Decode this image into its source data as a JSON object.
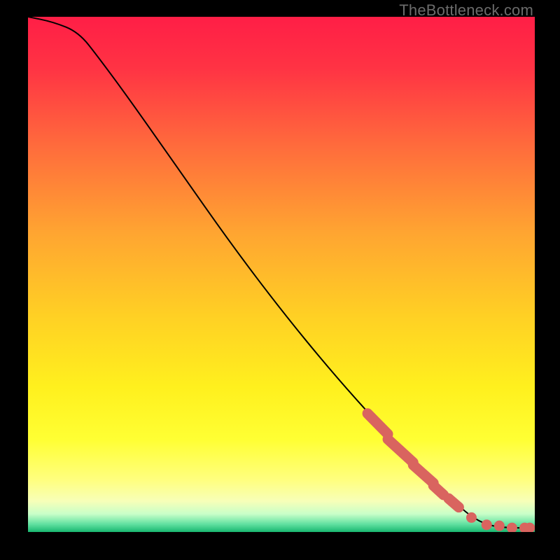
{
  "watermark": "TheBottleneck.com",
  "colors": {
    "marker": "#d9645f"
  },
  "chart_data": {
    "type": "line",
    "title": "",
    "xlabel": "",
    "ylabel": "",
    "xlim": [
      0,
      100
    ],
    "ylim": [
      0,
      100
    ],
    "grid": false,
    "legend": false,
    "curve": [
      {
        "x": 0,
        "y": 100
      },
      {
        "x": 5,
        "y": 99
      },
      {
        "x": 10,
        "y": 97
      },
      {
        "x": 14,
        "y": 92
      },
      {
        "x": 20,
        "y": 84
      },
      {
        "x": 30,
        "y": 70
      },
      {
        "x": 40,
        "y": 56
      },
      {
        "x": 50,
        "y": 43
      },
      {
        "x": 60,
        "y": 31
      },
      {
        "x": 70,
        "y": 20
      },
      {
        "x": 80,
        "y": 10
      },
      {
        "x": 86,
        "y": 4
      },
      {
        "x": 90,
        "y": 1.5
      },
      {
        "x": 94,
        "y": 0.8
      },
      {
        "x": 100,
        "y": 0.8
      }
    ],
    "marker_segments": [
      {
        "x0": 67,
        "y0": 23,
        "x1": 71,
        "y1": 19
      },
      {
        "x0": 71,
        "y0": 18,
        "x1": 76,
        "y1": 13.5
      },
      {
        "x0": 76,
        "y0": 13,
        "x1": 80,
        "y1": 9.5
      },
      {
        "x0": 80,
        "y0": 9,
        "x1": 82,
        "y1": 7.2
      },
      {
        "x0": 83,
        "y0": 6.5,
        "x1": 85,
        "y1": 4.8
      }
    ],
    "marker_points": [
      {
        "x": 87.5,
        "y": 2.8
      },
      {
        "x": 90.5,
        "y": 1.4
      },
      {
        "x": 93,
        "y": 1.2
      },
      {
        "x": 95.5,
        "y": 0.8
      },
      {
        "x": 98,
        "y": 0.8
      },
      {
        "x": 99,
        "y": 0.8
      }
    ]
  }
}
